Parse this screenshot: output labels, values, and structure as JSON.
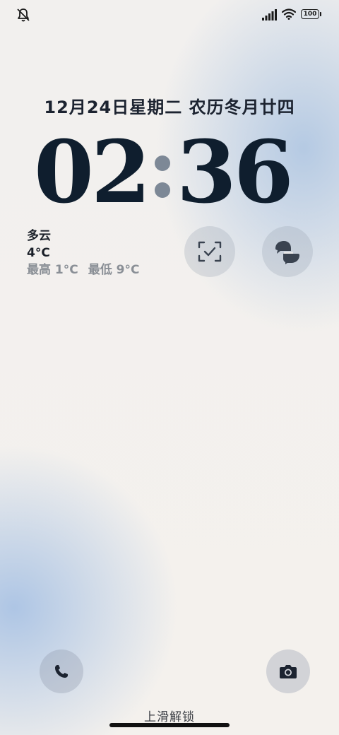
{
  "status_bar": {
    "icons": [
      "bell-off-icon",
      "signal-icon",
      "wifi-icon"
    ],
    "battery_level": "100"
  },
  "lock_screen": {
    "date_line": "12月24日星期二  农历冬月廿四",
    "time_hours": "02",
    "time_minutes": "36",
    "weather": {
      "condition": "多云",
      "temperature": "4°C",
      "high": "最高 1°C",
      "low": "最低 9°C"
    },
    "shortcuts": [
      "scan-icon",
      "translate-icon"
    ],
    "bottom_actions": [
      "phone-icon",
      "camera-icon"
    ],
    "unlock_hint": "上滑解锁"
  },
  "colors": {
    "clock": "#0f1e2e",
    "colon": "#7d8896",
    "accent_blue": "#aac3e1"
  }
}
